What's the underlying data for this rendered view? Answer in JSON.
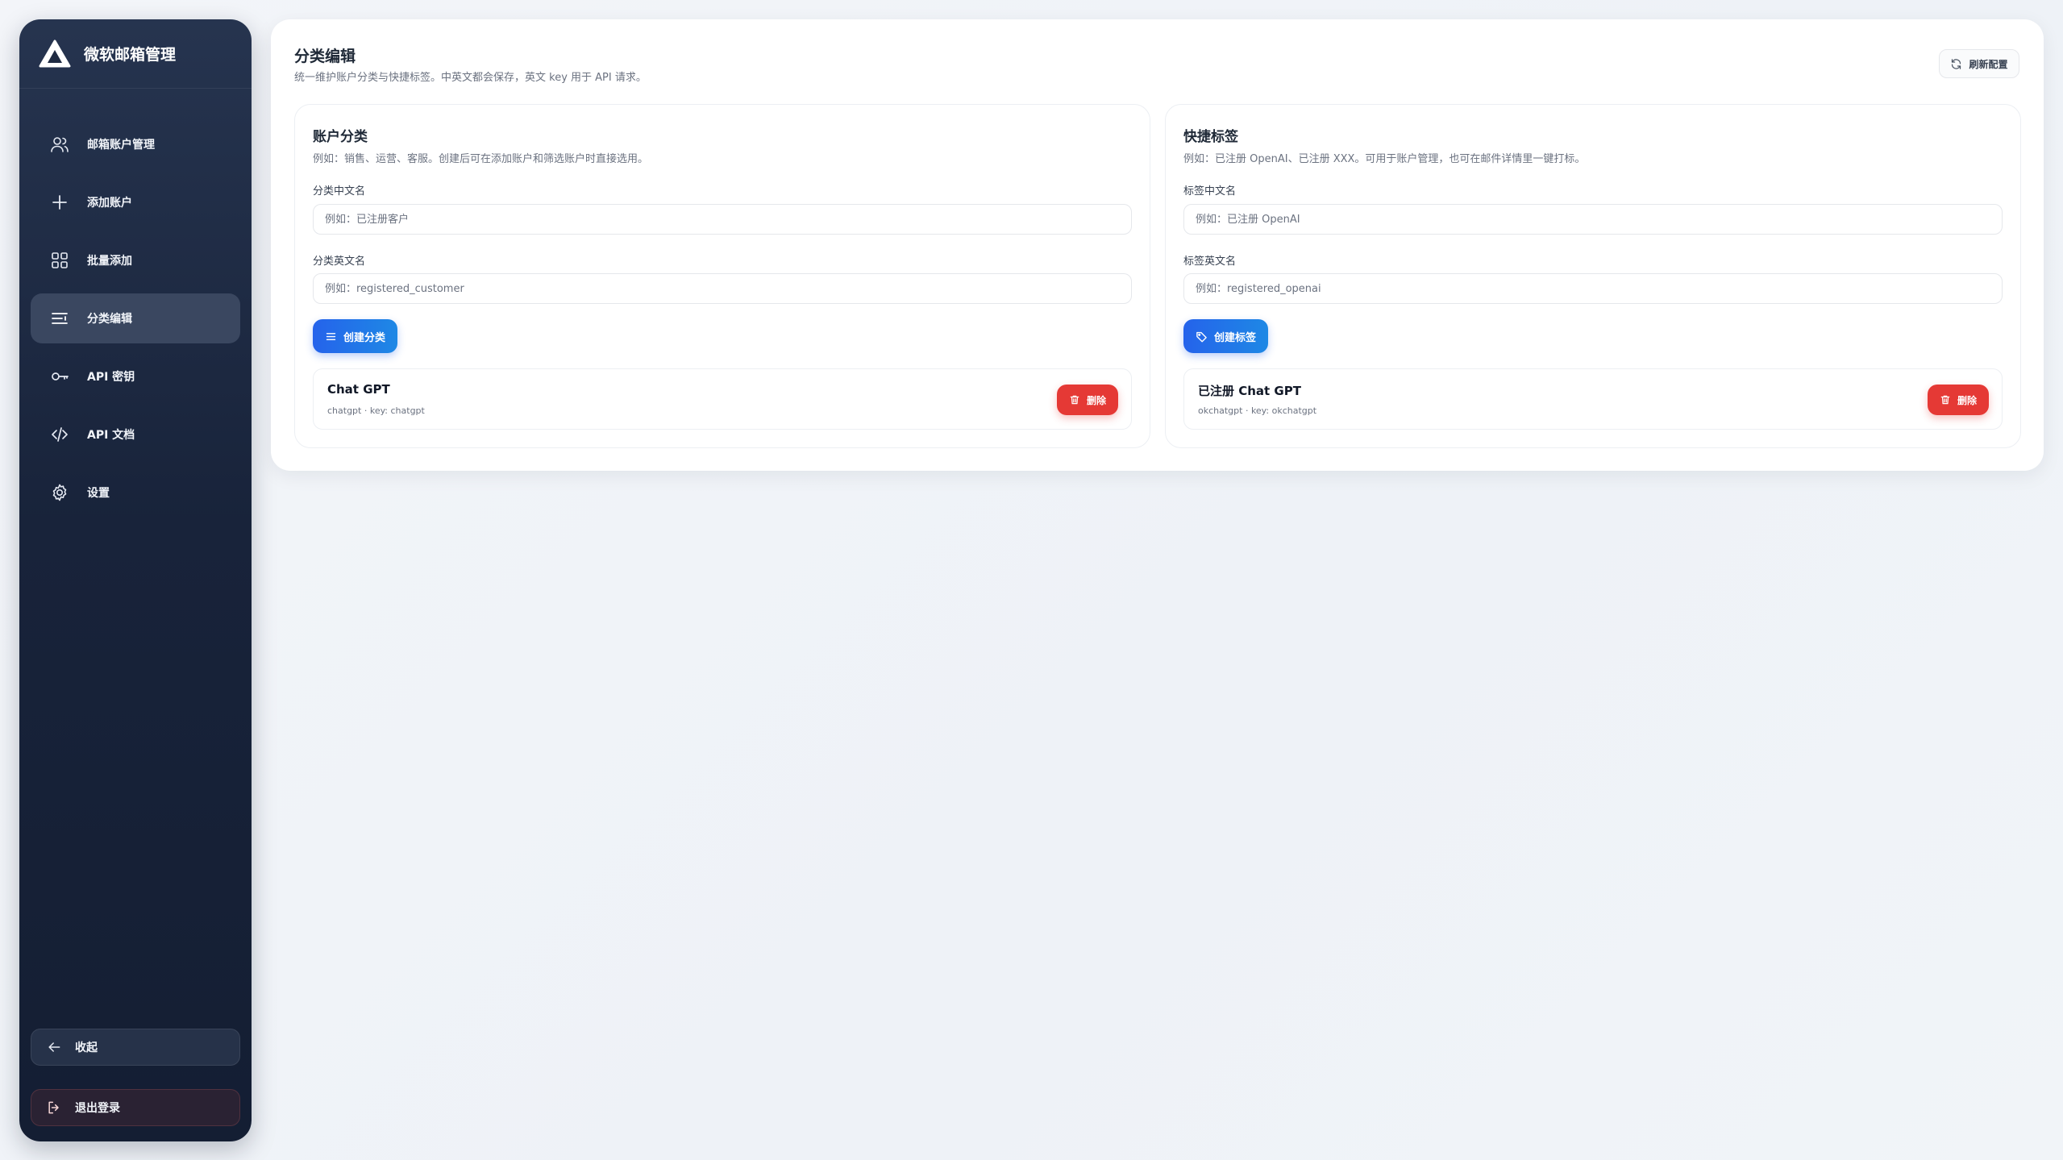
{
  "app": {
    "title": "微软邮箱管理",
    "logo_icon": "triangle-logo-icon"
  },
  "sidebar": {
    "items": [
      {
        "label": "邮箱账户管理",
        "icon": "users-icon",
        "active": false
      },
      {
        "label": "添加账户",
        "icon": "plus-icon",
        "active": false
      },
      {
        "label": "批量添加",
        "icon": "grid-icon",
        "active": false
      },
      {
        "label": "分类编辑",
        "icon": "list-edit-icon",
        "active": true
      },
      {
        "label": "API 密钥",
        "icon": "key-icon",
        "active": false
      },
      {
        "label": "API 文档",
        "icon": "code-icon",
        "active": false
      },
      {
        "label": "设置",
        "icon": "gear-icon",
        "active": false
      }
    ],
    "collapse_label": "收起",
    "logout_label": "退出登录"
  },
  "header": {
    "title": "分类编辑",
    "subtitle": "统一维护账户分类与快捷标签。中英文都会保存，英文 key 用于 API 请求。",
    "refresh_label": "刷新配置"
  },
  "categories": {
    "title": "账户分类",
    "description": "例如：销售、运营、客服。创建后可在添加账户和筛选账户时直接选用。",
    "cn_label": "分类中文名",
    "cn_placeholder": "例如：已注册客户",
    "en_label": "分类英文名",
    "en_placeholder": "例如：registered_customer",
    "create_label": "创建分类",
    "items": [
      {
        "name": "Chat GPT",
        "meta": "chatgpt · key: chatgpt",
        "delete_label": "删除"
      }
    ]
  },
  "tags": {
    "title": "快捷标签",
    "description": "例如：已注册 OpenAI、已注册 XXX。可用于账户管理，也可在邮件详情里一键打标。",
    "cn_label": "标签中文名",
    "cn_placeholder": "例如：已注册 OpenAI",
    "en_label": "标签英文名",
    "en_placeholder": "例如：registered_openai",
    "create_label": "创建标签",
    "items": [
      {
        "name": "已注册 Chat GPT",
        "meta": "okchatgpt · key: okchatgpt",
        "delete_label": "删除"
      }
    ]
  },
  "colors": {
    "sidebar_bg": "#1a253c",
    "primary": "#2563eb",
    "danger": "#e53935"
  }
}
